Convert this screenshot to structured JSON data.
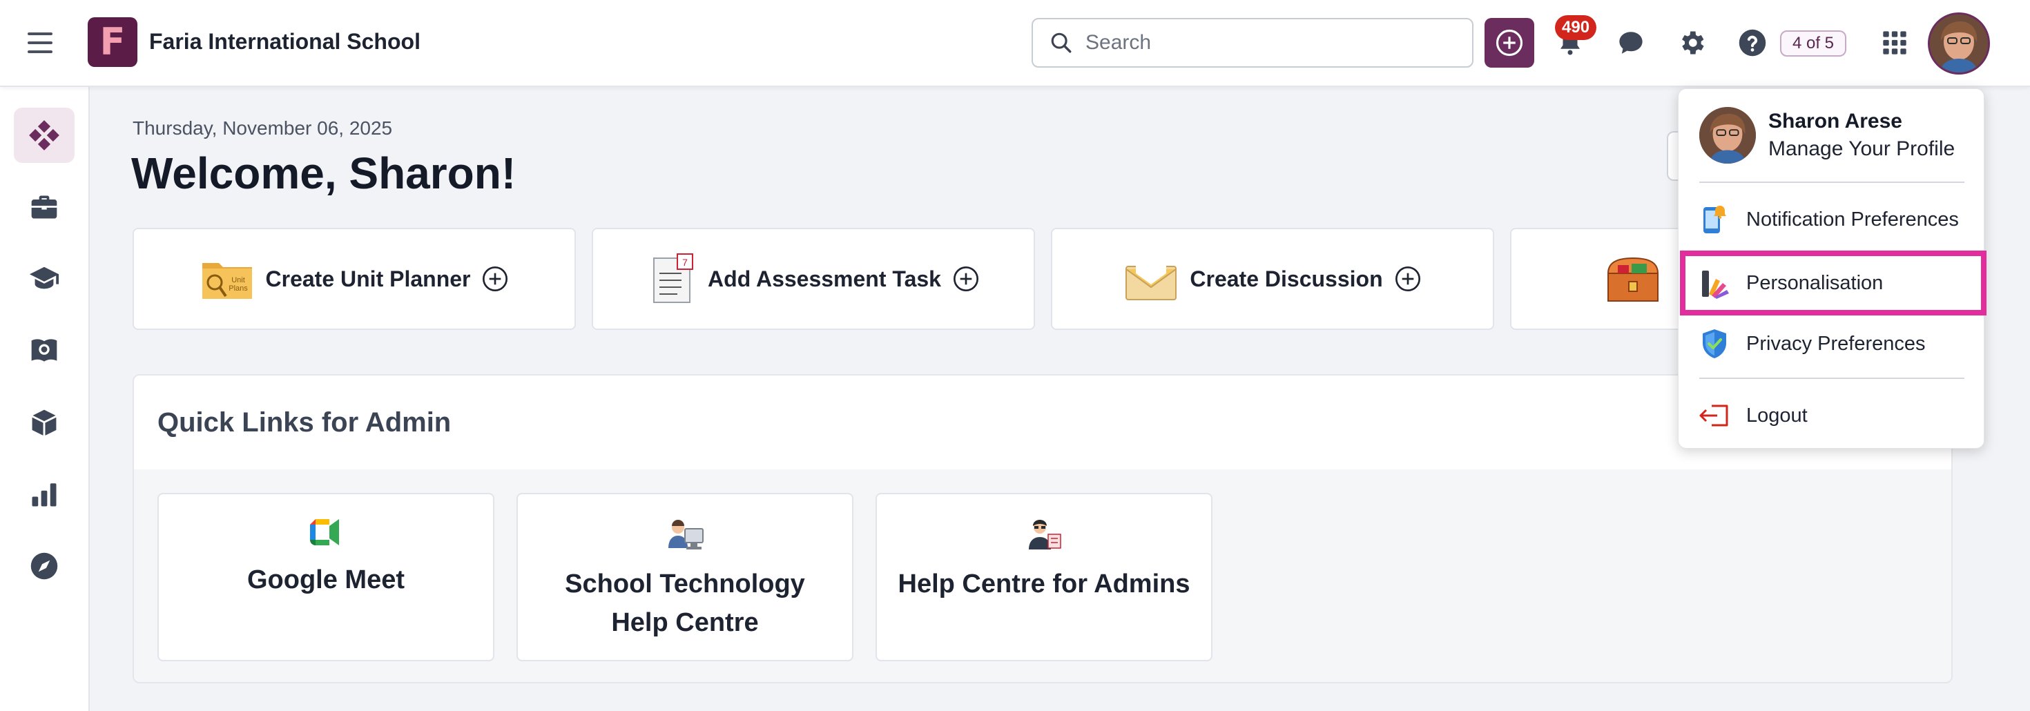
{
  "header": {
    "school_name": "Faria International School",
    "logo_letter": "F",
    "search_placeholder": "Search",
    "notification_count": "490",
    "guide_progress": "4 of 5"
  },
  "sidebar": {
    "items": [
      {
        "name": "dashboard",
        "active": true
      },
      {
        "name": "briefcase"
      },
      {
        "name": "graduation-cap"
      },
      {
        "name": "atlas-book"
      },
      {
        "name": "cube"
      },
      {
        "name": "bar-chart"
      },
      {
        "name": "compass"
      }
    ]
  },
  "main": {
    "date": "Thursday, November 06, 2025",
    "welcome": "Welcome, Sharon!",
    "actions": [
      {
        "label": "Create Unit Planner",
        "icon": "unit-plans-folder-icon"
      },
      {
        "label": "Add Assessment Task",
        "icon": "assessment-list-icon"
      },
      {
        "label": "Create Discussion",
        "icon": "envelope-icon"
      },
      {
        "label": "",
        "icon": "treasure-chest-icon"
      }
    ],
    "quick_links": {
      "title": "Quick Links for Admin",
      "items": [
        {
          "label": "Google Meet",
          "icon": "google-meet-icon"
        },
        {
          "label": "School Technology Help Centre",
          "icon": "tech-support-icon"
        },
        {
          "label": "Help Centre for Admins",
          "icon": "admin-help-icon"
        }
      ]
    }
  },
  "profile_menu": {
    "name": "Sharon Arese",
    "subtitle": "Manage Your Profile",
    "items": [
      {
        "label": "Notification Preferences",
        "icon": "phone-bell-icon"
      },
      {
        "label": "Personalisation",
        "icon": "paint-palette-icon",
        "highlighted": true
      },
      {
        "label": "Privacy Preferences",
        "icon": "shield-check-icon"
      },
      {
        "label": "Logout",
        "icon": "logout-icon"
      }
    ],
    "highlight_color": "#e22d9c"
  },
  "colors": {
    "brand": "#6b2d5e",
    "badge": "#d2261d",
    "background": "#f2f3f6"
  }
}
